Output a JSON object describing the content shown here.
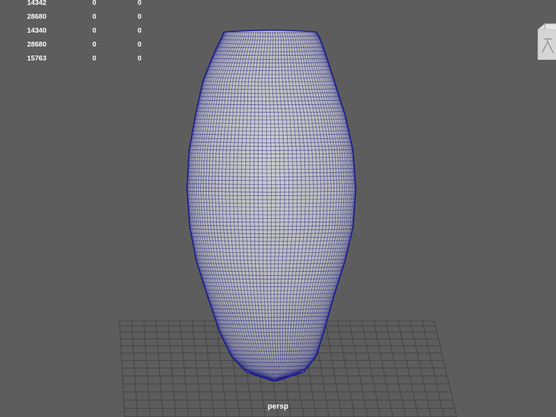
{
  "viewport": {
    "camera_name": "persp",
    "background_color": "#5d5d5d",
    "grid_color": "#3c3c3c",
    "mesh_fill_color": "#bcbcbc",
    "wireframe_color": "#1c1c88"
  },
  "hud_stats": [
    [
      "14342",
      "0",
      "0"
    ],
    [
      "28680",
      "0",
      "0"
    ],
    [
      "14340",
      "0",
      "0"
    ],
    [
      "28680",
      "0",
      "0"
    ],
    [
      "15763",
      "0",
      "0"
    ]
  ],
  "view_cube": {
    "icon": "view-cube-icon"
  }
}
